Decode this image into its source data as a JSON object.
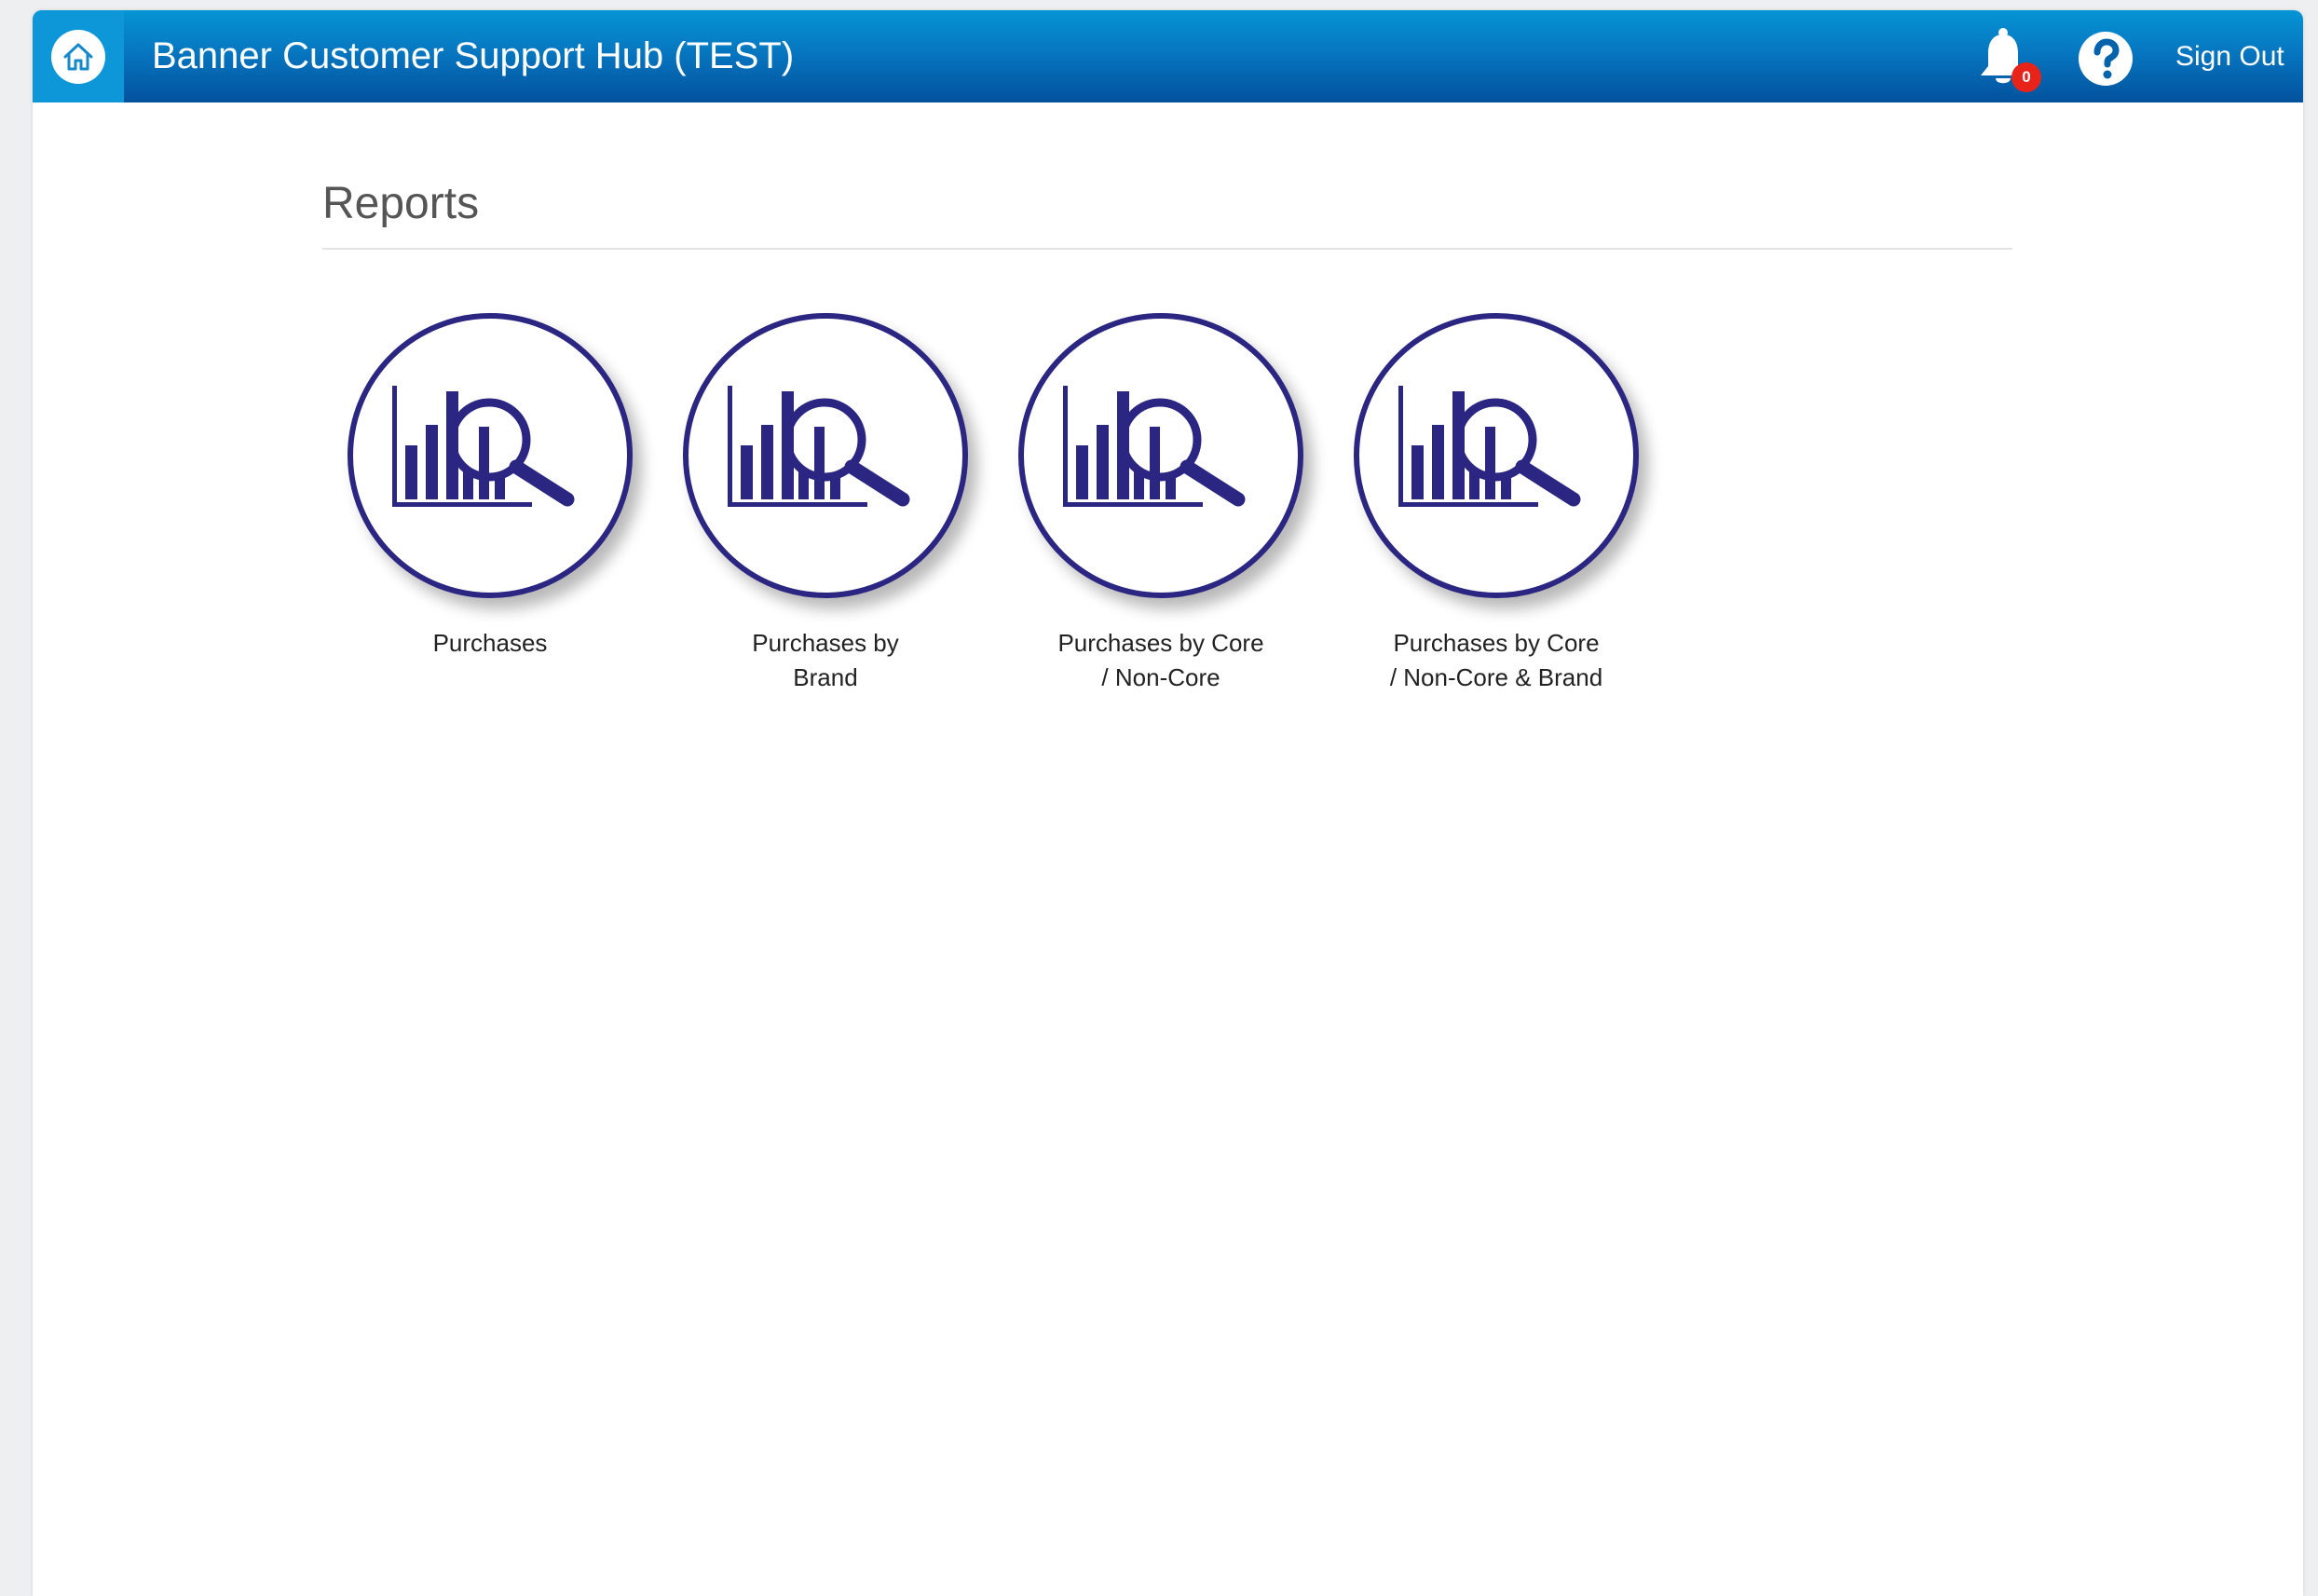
{
  "header": {
    "title": "Banner Customer Support Hub (TEST)",
    "notification_count": "0",
    "sign_out_label": "Sign Out"
  },
  "main": {
    "heading": "Reports",
    "reports": [
      {
        "label": "Purchases",
        "icon": "report-chart-icon"
      },
      {
        "label": "Purchases by Brand",
        "icon": "report-chart-icon"
      },
      {
        "label": "Purchases by Core / Non-Core",
        "icon": "report-chart-icon"
      },
      {
        "label": "Purchases by Core / Non-Core & Brand",
        "icon": "report-chart-icon"
      }
    ]
  },
  "colors": {
    "header_top": "#0594d4",
    "header_bottom": "#04519d",
    "home_button": "#0d97d8",
    "icon_accent": "#2b2681",
    "badge": "#e8231a"
  }
}
